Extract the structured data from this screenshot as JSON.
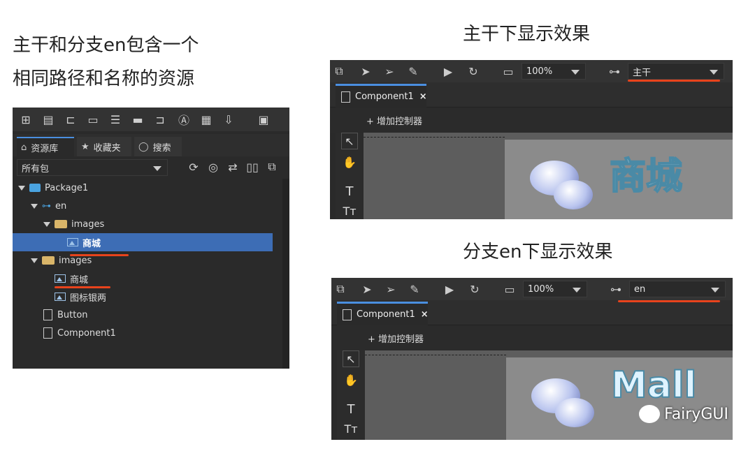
{
  "captions": {
    "left_line1": "主干和分支en包含一个",
    "left_line2": "相同路径和名称的资源",
    "top_right": "主干下显示效果",
    "bottom_right": "分支en下显示效果"
  },
  "library": {
    "tabs": [
      "资源库",
      "收藏夹",
      "搜索"
    ],
    "package_filter": "所有包",
    "tree": [
      {
        "label": "Package1",
        "kind": "package"
      },
      {
        "label": "en",
        "kind": "branch"
      },
      {
        "label": "images",
        "kind": "folder"
      },
      {
        "label": "商城",
        "kind": "image",
        "selected": true
      },
      {
        "label": "images",
        "kind": "folder"
      },
      {
        "label": "商城",
        "kind": "image"
      },
      {
        "label": "图标银两",
        "kind": "image"
      },
      {
        "label": "Button",
        "kind": "component"
      },
      {
        "label": "Component1",
        "kind": "component"
      }
    ]
  },
  "editor_top": {
    "zoom": "100%",
    "branch": "主干",
    "tab": "Component1",
    "tab_close": "×",
    "controller_label": "+ 增加控制器",
    "stage_text": "商城"
  },
  "editor_bottom": {
    "zoom": "100%",
    "branch": "en",
    "tab": "Component1",
    "tab_close": "×",
    "controller_label": "+ 增加控制器",
    "stage_text": "Mall"
  },
  "watermark": "FairyGUI",
  "colors": {
    "accent": "#4a8fe0",
    "selection": "#3d6db5",
    "underline": "#e8431c"
  }
}
